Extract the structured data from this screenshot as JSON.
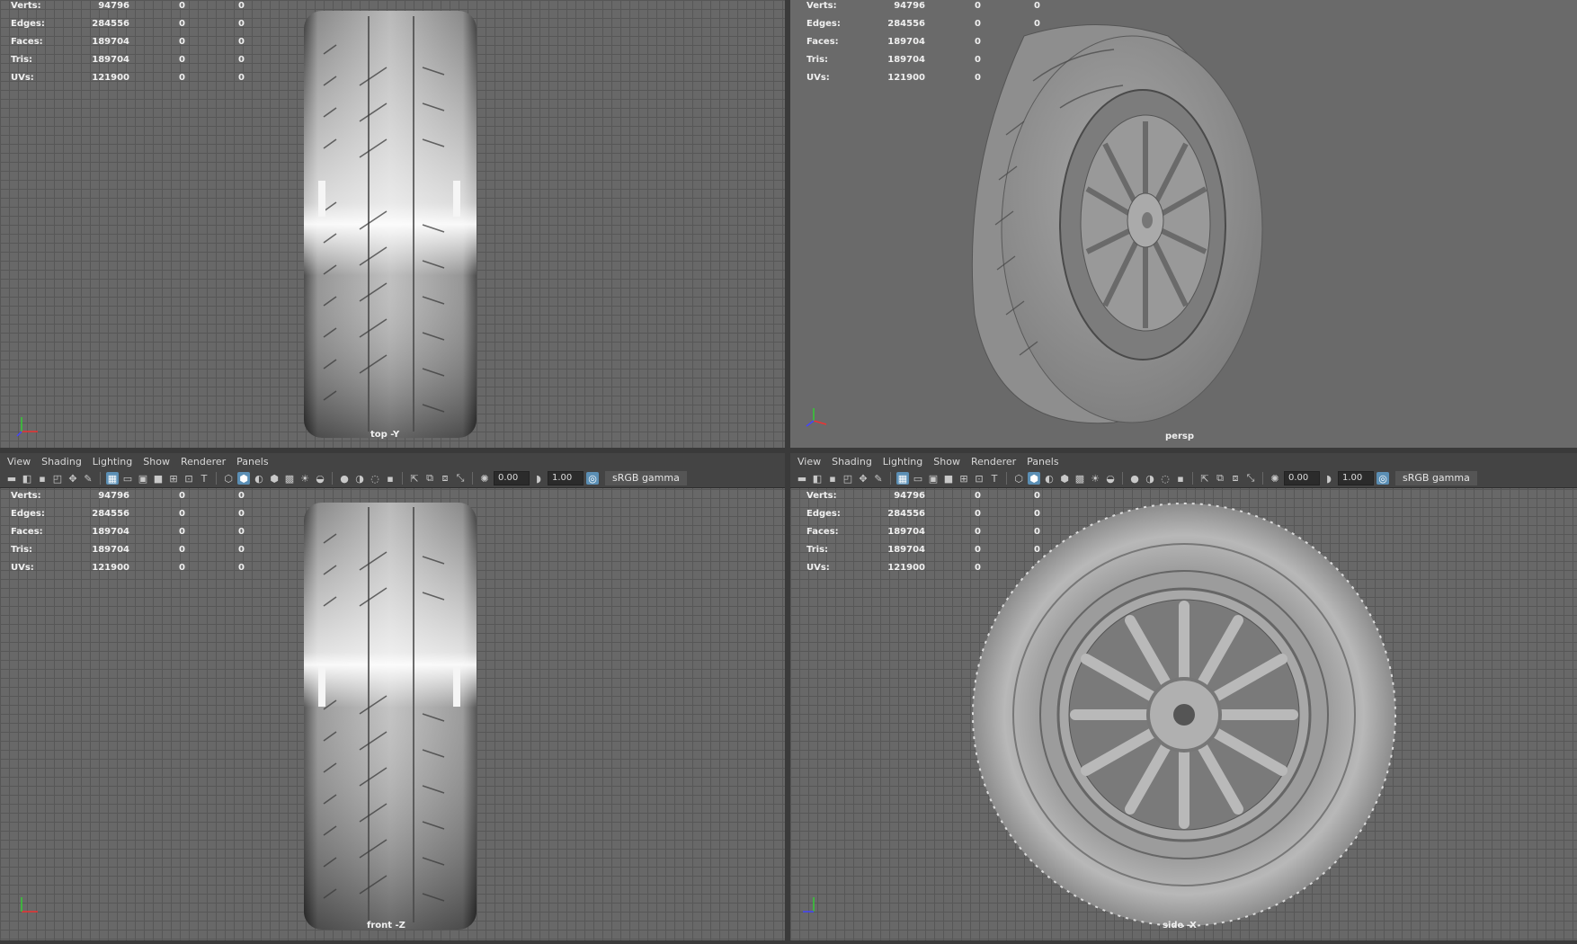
{
  "menu": [
    "View",
    "Shading",
    "Lighting",
    "Show",
    "Renderer",
    "Panels"
  ],
  "toolbar": {
    "exposure": "0.00",
    "gamma_value": "1.00",
    "color_space": "sRGB gamma"
  },
  "hud": {
    "rows": [
      {
        "label": "Verts:",
        "v1": "94796",
        "v2": "0",
        "v3": "0"
      },
      {
        "label": "Edges:",
        "v1": "284556",
        "v2": "0",
        "v3": "0"
      },
      {
        "label": "Faces:",
        "v1": "189704",
        "v2": "0",
        "v3": "0"
      },
      {
        "label": "Tris:",
        "v1": "189704",
        "v2": "0",
        "v3": "0"
      },
      {
        "label": "UVs:",
        "v1": "121900",
        "v2": "0",
        "v3": "0"
      }
    ]
  },
  "viewports": {
    "top": {
      "camera": "top -Y"
    },
    "persp": {
      "camera": "persp"
    },
    "front": {
      "camera": "front -Z"
    },
    "side": {
      "camera": "side -X"
    }
  },
  "colors": {
    "accent": "#5b8fb5",
    "grid": "#575757",
    "bg": "#686868"
  }
}
